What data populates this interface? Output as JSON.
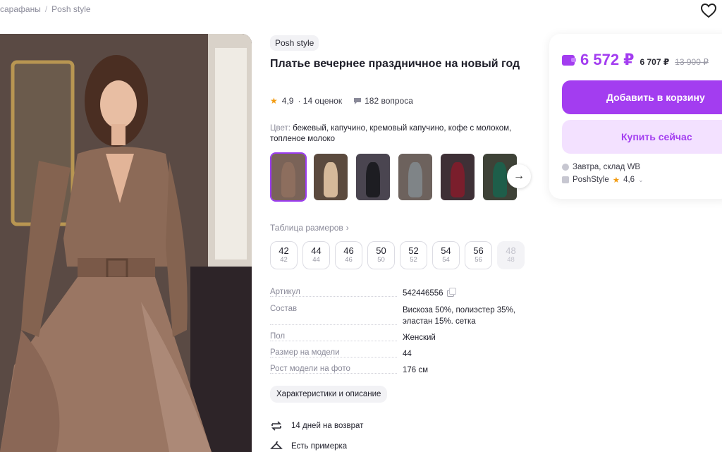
{
  "breadcrumb": {
    "item1": "сарафаны",
    "separator": "/",
    "item2": "Posh style"
  },
  "product": {
    "brand": "Posh style",
    "title": "Платье вечернее праздничное на новый год",
    "rating": "4,9",
    "reviews": "· 14 оценок",
    "questions": "182 вопроса",
    "color_label": "Цвет:",
    "color_value": "бежевый, капучино, кремовый капучино, кофе с молоком, топленое молоко"
  },
  "thumbnails": [
    {
      "bg": "#7a6358",
      "dress": "#8d6e5e",
      "selected": true
    },
    {
      "bg": "#5b4a3e",
      "dress": "#d6b99a",
      "selected": false
    },
    {
      "bg": "#4a4550",
      "dress": "#1d1d22",
      "selected": false
    },
    {
      "bg": "#6d625d",
      "dress": "#7f8487",
      "selected": false
    },
    {
      "bg": "#3e3036",
      "dress": "#7a1e2c",
      "selected": false
    },
    {
      "bg": "#3e4237",
      "dress": "#1e5e4a",
      "selected": false
    }
  ],
  "size_table_label": "Таблица размеров",
  "sizes": [
    {
      "big": "42",
      "small": "42",
      "available": true
    },
    {
      "big": "44",
      "small": "44",
      "available": true
    },
    {
      "big": "46",
      "small": "46",
      "available": true
    },
    {
      "big": "50",
      "small": "50",
      "available": true
    },
    {
      "big": "52",
      "small": "52",
      "available": true
    },
    {
      "big": "54",
      "small": "54",
      "available": true
    },
    {
      "big": "56",
      "small": "56",
      "available": true
    },
    {
      "big": "48",
      "small": "48",
      "available": false
    }
  ],
  "specs": {
    "article": {
      "key": "Артикул",
      "value": "542446556"
    },
    "composition": {
      "key": "Состав",
      "value": "Вискоза 50%, полиэстер 35%, эластан 15%. сетка"
    },
    "gender": {
      "key": "Пол",
      "value": "Женский"
    },
    "model_size": {
      "key": "Размер на модели",
      "value": "44"
    },
    "model_height": {
      "key": "Рост модели на фото",
      "value": "176 см"
    }
  },
  "characteristics_button": "Характеристики и описание",
  "perks": {
    "returns": "14 дней на возврат",
    "fitting": "Есть примерка"
  },
  "price": {
    "main": "6 572 ₽",
    "alt": "6 707 ₽",
    "old": "13 900 ₽",
    "add_to_cart": "Добавить в корзину",
    "buy_now": "Купить сейчас",
    "delivery": "Завтра, склад WB",
    "seller": "PoshStyle",
    "seller_rating": "4,6"
  },
  "colors": {
    "accent": "#a33df0",
    "accent_light": "#f3e1ff",
    "star": "#f39c12"
  }
}
